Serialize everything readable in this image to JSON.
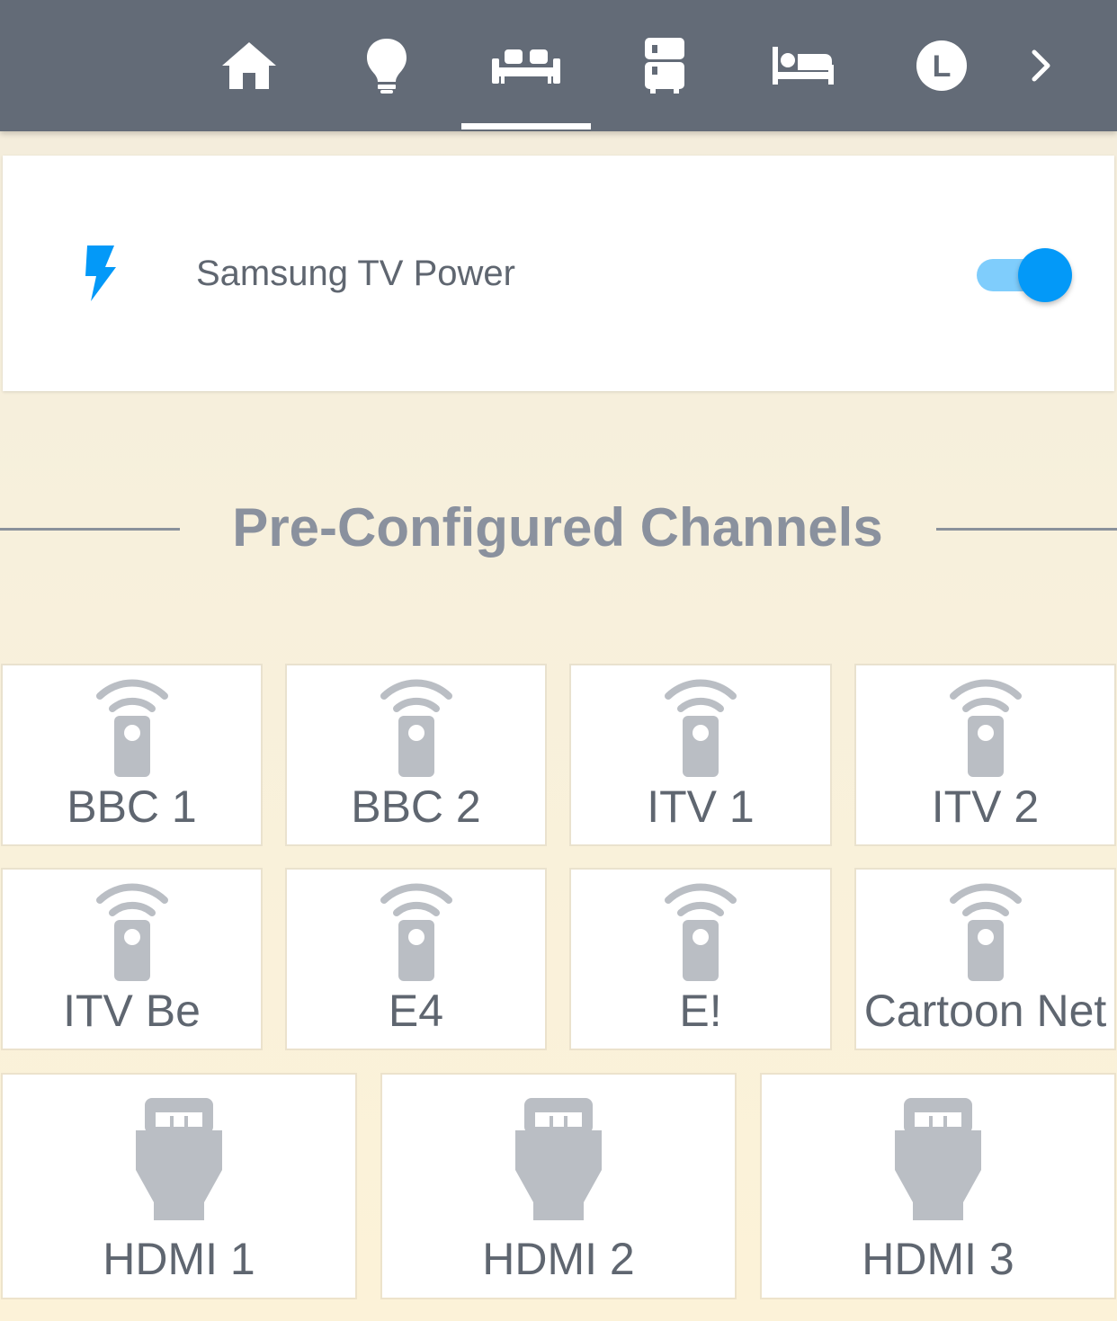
{
  "nav": {
    "tabs": [
      {
        "icon": "home-icon",
        "active": false
      },
      {
        "icon": "lightbulb-icon",
        "active": false
      },
      {
        "icon": "sofa-icon",
        "active": true
      },
      {
        "icon": "fridge-icon",
        "active": false
      },
      {
        "icon": "bed-icon",
        "active": false
      },
      {
        "icon": "letter-l-icon",
        "letter": "L",
        "active": false
      }
    ],
    "more_icon": "chevron-right-icon"
  },
  "power": {
    "icon": "lightning-bolt-icon",
    "label": "Samsung TV Power",
    "on": true
  },
  "section": {
    "title": "Pre-Configured Channels"
  },
  "channels": [
    {
      "label": "BBC 1",
      "icon": "remote-control-icon"
    },
    {
      "label": "BBC 2",
      "icon": "remote-control-icon"
    },
    {
      "label": "ITV 1",
      "icon": "remote-control-icon"
    },
    {
      "label": "ITV 2",
      "icon": "remote-control-icon"
    },
    {
      "label": "ITV Be",
      "icon": "remote-control-icon"
    },
    {
      "label": "E4",
      "icon": "remote-control-icon"
    },
    {
      "label": "E!",
      "icon": "remote-control-icon"
    },
    {
      "label": "Cartoon Net",
      "icon": "remote-control-icon"
    }
  ],
  "inputs": [
    {
      "label": "HDMI 1",
      "icon": "hdmi-connector-icon"
    },
    {
      "label": "HDMI 2",
      "icon": "hdmi-connector-icon"
    },
    {
      "label": "HDMI 3",
      "icon": "hdmi-connector-icon"
    }
  ],
  "colors": {
    "topbar": "#636b77",
    "accent": "#0399f8",
    "accent_light": "#7fcdfc",
    "icon_grey": "#babec4",
    "text": "#5f6670"
  }
}
